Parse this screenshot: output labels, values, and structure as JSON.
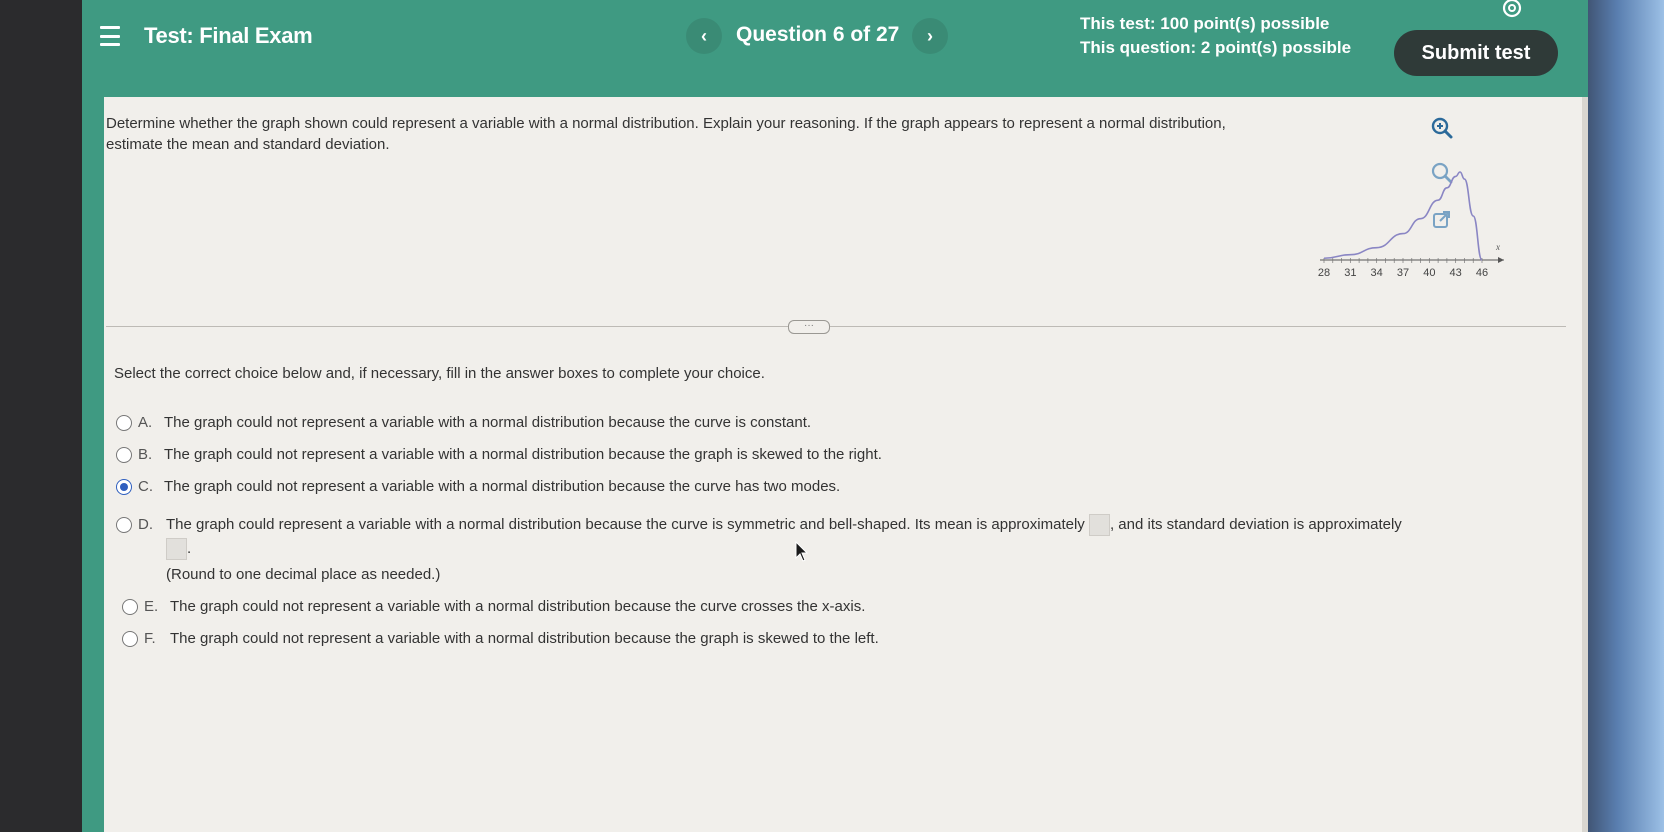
{
  "header": {
    "test_title": "Test: Final Exam",
    "question_counter": "Question 6 of 27",
    "prev_symbol": "‹",
    "next_symbol": "›",
    "test_points": "This test: 100 point(s) possible",
    "question_points": "This question: 2 point(s) possible",
    "submit_label": "Submit test"
  },
  "question": {
    "prompt": "Determine whether the graph shown could represent a variable with a normal distribution. Explain your reasoning. If the graph appears to represent a normal distribution, estimate the mean and standard deviation."
  },
  "tools": [
    "zoom-in-icon",
    "zoom-out-icon",
    "open-external-icon"
  ],
  "chart_data": {
    "type": "line",
    "x_tick_labels": [
      "28",
      "31",
      "34",
      "37",
      "40",
      "43",
      "46"
    ],
    "xlabel": "x",
    "ylabel": "",
    "title": "",
    "xlim": [
      28,
      46
    ],
    "x": [
      28,
      31,
      34,
      37,
      39,
      41,
      42,
      43,
      43.5,
      44,
      45,
      46
    ],
    "y": [
      0.02,
      0.06,
      0.14,
      0.3,
      0.47,
      0.68,
      0.82,
      0.95,
      1.0,
      0.92,
      0.5,
      0.0
    ],
    "grid": false,
    "color": "#8a86c4"
  },
  "answer_section": {
    "instructions": "Select the correct choice below and, if necessary, fill in the answer boxes to complete your choice.",
    "choices": [
      {
        "letter": "A.",
        "text": "The graph could not represent a variable with a normal distribution because the curve is constant.",
        "selected": false
      },
      {
        "letter": "B.",
        "text": "The graph could not represent a variable with a normal distribution because the graph is skewed to the right.",
        "selected": false
      },
      {
        "letter": "C.",
        "text": "The graph could not represent a variable with a normal distribution because the curve has two modes.",
        "selected": true
      },
      {
        "letter": "D.",
        "text_before_box1": "The graph could represent a variable with a normal distribution because the curve is symmetric and bell-shaped. Its mean is approximately",
        "text_after_box1": ", and its standard deviation is approximately",
        "text_after_box2": ".",
        "note": "(Round to one decimal place as needed.)",
        "mean_value": "",
        "std_value": "",
        "selected": false
      },
      {
        "letter": "E.",
        "text": "The graph could not represent a variable with a normal distribution because the curve crosses the x-axis.",
        "selected": false
      },
      {
        "letter": "F.",
        "text": "The graph could not represent a variable with a normal distribution because the graph is skewed to the left.",
        "selected": false
      }
    ]
  },
  "colors": {
    "header_bg": "#3f9a82",
    "submit_bg": "#2f3a38",
    "page_bg": "#f1efeb",
    "radio_selected": "#2f5fbf"
  }
}
